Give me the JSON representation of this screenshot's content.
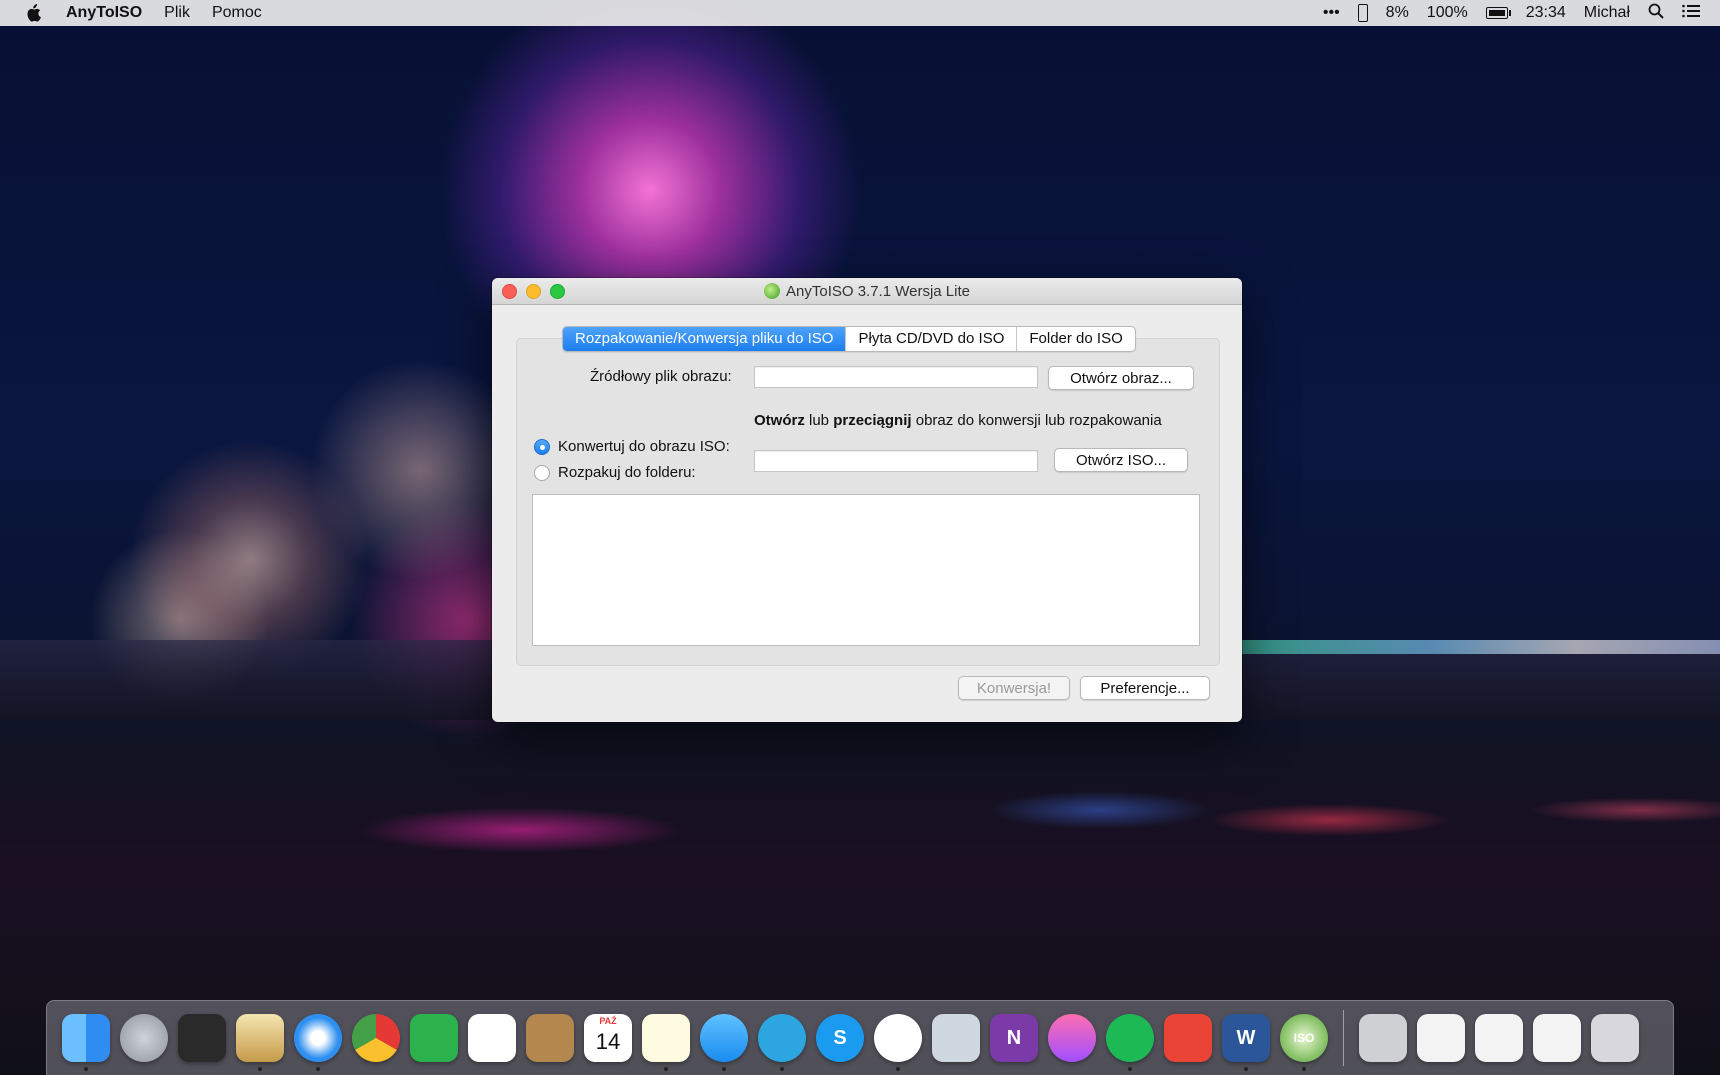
{
  "menubar": {
    "app_name": "AnyToISO",
    "menus": [
      "Plik",
      "Pomoc"
    ],
    "status": {
      "more": "•••",
      "phone_battery": "8%",
      "battery": "100%",
      "time": "23:34",
      "user": "Michał"
    }
  },
  "window": {
    "title": "AnyToISO 3.7.1 Wersja Lite",
    "tabs": [
      {
        "label": "Rozpakowanie/Konwersja pliku do ISO",
        "active": true
      },
      {
        "label": "Płyta CD/DVD do ISO",
        "active": false
      },
      {
        "label": "Folder do ISO",
        "active": false
      }
    ],
    "source_label": "Źródłowy plik obrazu:",
    "source_value": "",
    "open_image_button": "Otwórz obraz...",
    "hint": {
      "part1": "Otwórz",
      "part2": " lub ",
      "part3": "przeciągnij",
      "part4": " obraz do konwersji lub rozpakowania"
    },
    "radio_convert": "Konwertuj do obrazu ISO:",
    "radio_extract": "Rozpakuj do folderu:",
    "iso_value": "",
    "open_iso_button": "Otwórz ISO...",
    "log_text": "",
    "convert_button": "Konwersja!",
    "preferences_button": "Preferencje..."
  },
  "dock": {
    "calendar_month": "PAŹ",
    "calendar_day": "14",
    "onenote_letter": "N",
    "word_letter": "W",
    "skype_letter": "S",
    "iso_label": "ISO"
  }
}
